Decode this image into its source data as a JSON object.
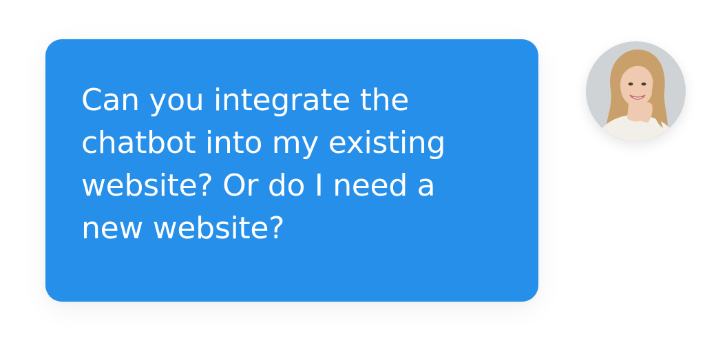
{
  "message": {
    "text": "Can you integrate the chatbot into my existing website? Or do I need a new website?",
    "bubble_color": "#258fe9",
    "text_color": "#ffffff"
  },
  "avatar": {
    "icon": "user-avatar",
    "background_color": "#cfd3d6",
    "hair_color": "#c9a06a",
    "skin_color": "#efc9b0",
    "shirt_color": "#f2efe9"
  }
}
